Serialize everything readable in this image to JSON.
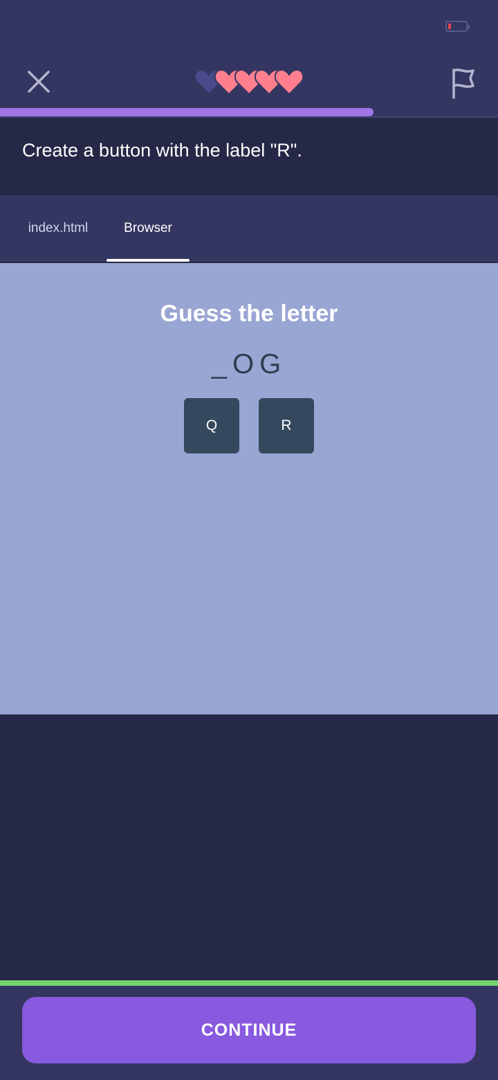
{
  "lesson": {
    "hearts": {
      "total": 5,
      "remaining": 4,
      "full_color": "#ff7f8f",
      "empty_color": "#494b8a"
    },
    "progress": {
      "fraction": 0.75,
      "color": "#a174e6"
    },
    "close_icon": "close-icon",
    "flag_icon": "flag-icon"
  },
  "instruction": {
    "text": "Create a button with the label \"R\"."
  },
  "tabs": [
    {
      "label": "index.html",
      "active": false
    },
    {
      "label": "Browser",
      "active": true
    }
  ],
  "browser": {
    "title": "Guess the letter",
    "word": "_OG",
    "buttons": [
      {
        "label": "Q"
      },
      {
        "label": "R"
      }
    ]
  },
  "footer": {
    "continue_label": "CONTINUE",
    "accent": "#885adf",
    "success_color": "#74d16c"
  }
}
